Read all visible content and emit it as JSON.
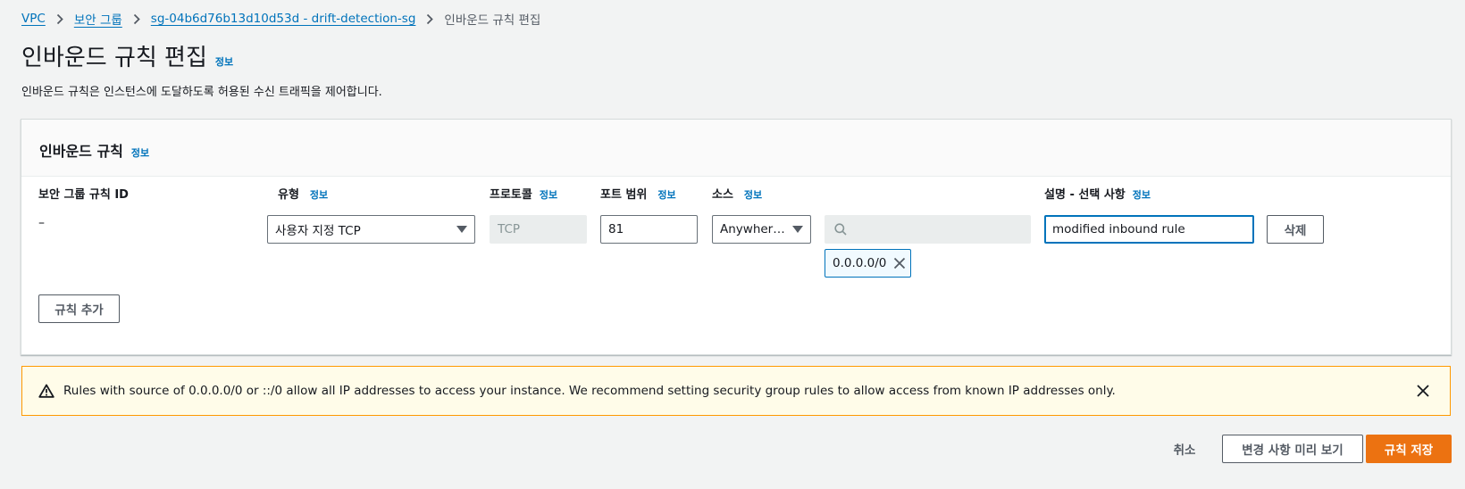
{
  "breadcrumb": {
    "vpc": "VPC",
    "security_groups": "보안 그룹",
    "sg": "sg-04b6d76b13d10d53d - drift-detection-sg",
    "current": "인바운드 규칙 편집"
  },
  "page": {
    "title": "인바운드 규칙 편집",
    "info": "정보",
    "description": "인바운드 규칙은 인스턴스에 도달하도록 허용된 수신 트래픽을 제어합니다."
  },
  "panel": {
    "title": "인바운드 규칙",
    "info": "정보",
    "columns": {
      "rule_id": "보안 그룹 규칙 ID",
      "type": "유형",
      "protocol": "프로토콜",
      "port_range": "포트 범위",
      "source": "소스",
      "description": "설명 - 선택 사항",
      "info": "정보"
    },
    "rule": {
      "rule_id": "–",
      "type": "사용자 지정 TCP",
      "protocol": "TCP",
      "port_range": "81",
      "source_type": "Anywher…",
      "source_search": "",
      "cidr_token": "0.0.0.0/0",
      "description": "modified inbound rule",
      "delete": "삭제"
    },
    "add_rule": "규칙 추가"
  },
  "warning": {
    "text": "Rules with source of 0.0.0.0/0 or ::/0 allow all IP addresses to access your instance. We recommend setting security group rules to allow access from known IP addresses only."
  },
  "footer": {
    "cancel": "취소",
    "preview": "변경 사항 미리 보기",
    "save": "규칙 저장"
  },
  "colors": {
    "link": "#0073bb",
    "primary": "#ec7211",
    "warning_border": "#ff9900",
    "warning_bg": "#fffce9"
  }
}
